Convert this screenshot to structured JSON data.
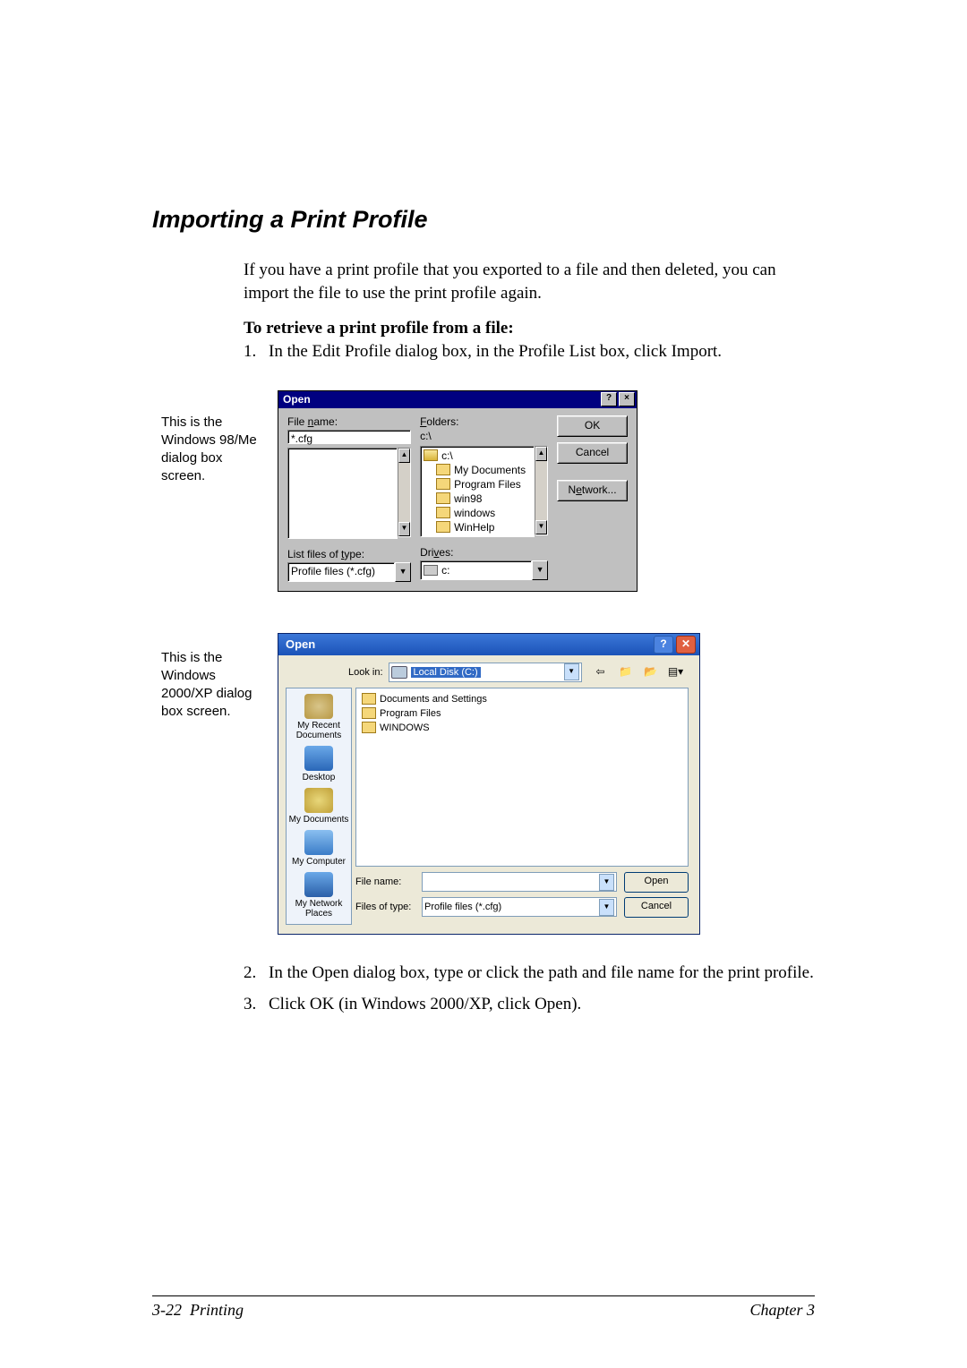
{
  "heading": "Importing a Print Profile",
  "intro": "If you have a print profile that you exported to a file and then deleted, you can import the file to use the print profile again.",
  "subheading": "To retrieve a print profile from a file:",
  "steps": {
    "s1_num": "1.",
    "s1_text": "In the Edit Profile dialog box, in the Profile List box, click Import.",
    "s2_num": "2.",
    "s2_text": "In the Open dialog box, type or click the path and file name for the print profile.",
    "s3_num": "3.",
    "s3_text": "Click OK (in Windows 2000/XP, click Open)."
  },
  "caption98_l1": "This is the",
  "caption98_l2": "Windows 98/Me",
  "caption98_l3": "dialog box",
  "caption98_l4": "screen.",
  "captionXP_l1": "This is the",
  "captionXP_l2": "Windows",
  "captionXP_l3": "2000/XP dialog",
  "captionXP_l4": "box screen.",
  "d98": {
    "title": "Open",
    "filename_label_pre": "File ",
    "filename_label_ul": "n",
    "filename_label_post": "ame:",
    "filename_value": "*.cfg",
    "folders_label_ul": "F",
    "folders_label_post": "olders:",
    "folders_path": "c:\\",
    "tree_root": "c:\\",
    "tree_items": [
      "My Documents",
      "Program Files",
      "win98",
      "windows",
      "WinHelp"
    ],
    "listtype_label_pre": "List files of ",
    "listtype_label_ul": "t",
    "listtype_label_post": "ype:",
    "listtype_value": "Profile files (*.cfg)",
    "drives_label_pre": "Dri",
    "drives_label_ul": "v",
    "drives_label_post": "es:",
    "drives_value": "c:",
    "ok": "OK",
    "cancel": "Cancel",
    "network_pre": "N",
    "network_ul": "e",
    "network_post": "twork..."
  },
  "dXP": {
    "title": "Open",
    "lookin_label": "Look in:",
    "lookin_value": "Local Disk (C:)",
    "places": {
      "recent_l1": "My Recent",
      "recent_l2": "Documents",
      "desktop": "Desktop",
      "docs": "My Documents",
      "comp": "My Computer",
      "net_l1": "My Network",
      "net_l2": "Places"
    },
    "filelist": [
      "Documents and Settings",
      "Program Files",
      "WINDOWS"
    ],
    "filename_label": "File name:",
    "filename_value": "",
    "filetype_label": "Files of type:",
    "filetype_value": "Profile files (*.cfg)",
    "open": "Open",
    "cancel": "Cancel"
  },
  "footer": {
    "left_page": "3-22",
    "left_section": "Printing",
    "right": "Chapter 3"
  }
}
